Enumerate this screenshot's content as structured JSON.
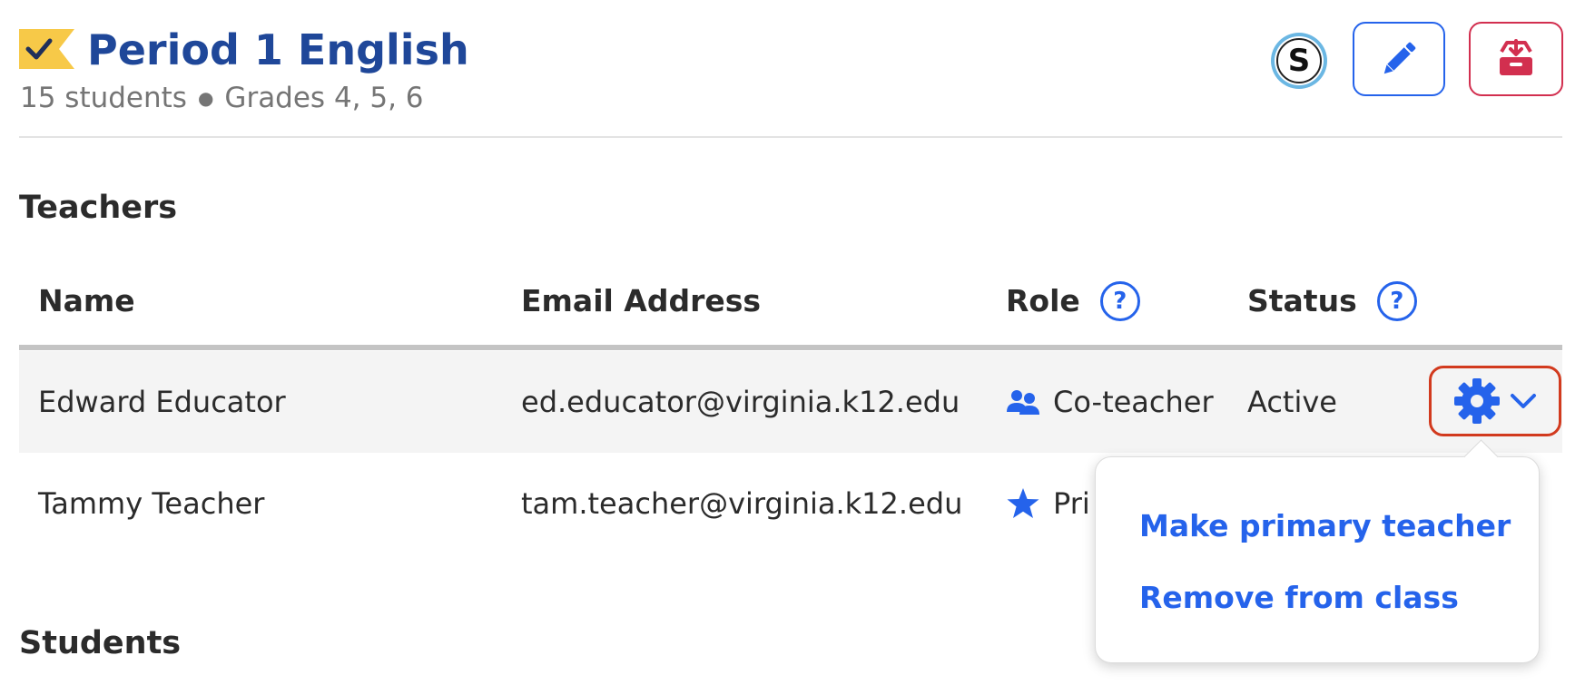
{
  "header": {
    "class_name": "Period 1 English",
    "student_count": "15 students",
    "grades": "Grades 4, 5, 6",
    "flag_color": "#f7c948",
    "title_color": "#1f4799",
    "actions": {
      "sync_letter": "S",
      "edit_icon": "pencil-icon",
      "archive_icon": "archive-icon"
    }
  },
  "teachers": {
    "section_title": "Teachers",
    "columns": {
      "name": "Name",
      "email": "Email Address",
      "role": "Role",
      "status": "Status"
    },
    "rows": [
      {
        "name": "Edward Educator",
        "email": "ed.educator@virginia.k12.edu",
        "role": "Co-teacher",
        "role_icon": "users-icon",
        "status": "Active"
      },
      {
        "name": "Tammy Teacher",
        "email": "tam.teacher@virginia.k12.edu",
        "role": "Pri",
        "role_icon": "star-icon",
        "status": ""
      }
    ]
  },
  "dropdown": {
    "items": [
      {
        "label": "Make primary teacher"
      },
      {
        "label": "Remove from class"
      }
    ]
  },
  "students": {
    "section_title": "Students"
  },
  "colors": {
    "accent_blue": "#2563eb",
    "danger_red": "#d22f4f",
    "highlight_red": "#d23a1e"
  }
}
